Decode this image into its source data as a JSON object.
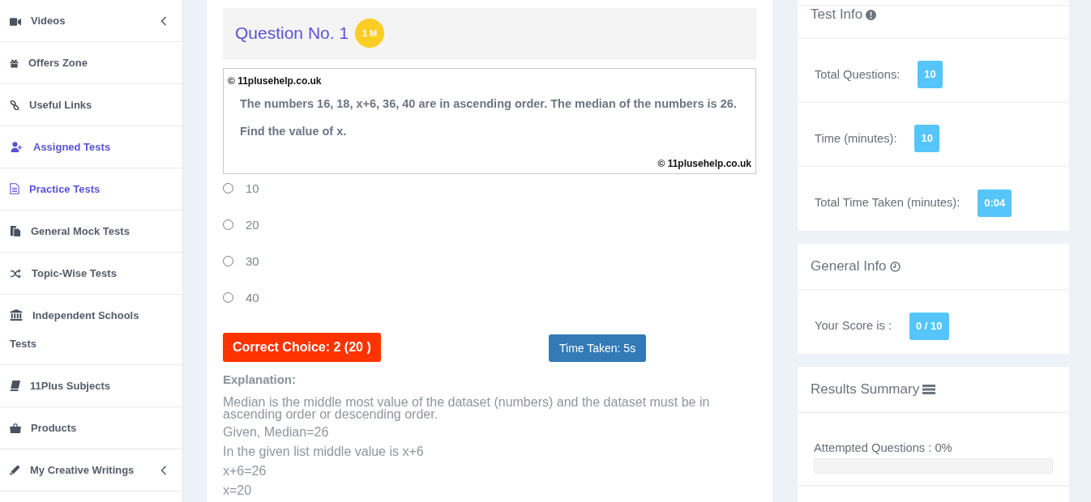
{
  "sidebar": {
    "items": [
      {
        "label": "Videos",
        "selected": false,
        "submenu": true
      },
      {
        "label": "Offers Zone",
        "selected": false,
        "submenu": false
      },
      {
        "label": "Useful Links",
        "selected": false,
        "submenu": false
      },
      {
        "label": "Assigned Tests",
        "selected": true,
        "submenu": false
      },
      {
        "label": "Practice Tests",
        "selected": true,
        "submenu": false
      },
      {
        "label": "General Mock Tests",
        "selected": false,
        "submenu": false
      },
      {
        "label": "Topic-Wise Tests",
        "selected": false,
        "submenu": false
      },
      {
        "label": "Independent Schools Tests",
        "selected": false,
        "submenu": false
      },
      {
        "label": "11Plus Subjects",
        "selected": false,
        "submenu": false
      },
      {
        "label": "Products",
        "selected": false,
        "submenu": false
      },
      {
        "label": "My Creative Writings",
        "selected": false,
        "submenu": true
      }
    ]
  },
  "question": {
    "title": "Question No. 1",
    "marks_badge": "1 M",
    "copyright_top": "© 11plusehelp.co.uk",
    "text_lines": [
      "The numbers 16, 18, x+6, 36, 40 are in ascending order. The median of the numbers is 26.",
      "Find the value of x."
    ],
    "copyright_bottom": "© 11plusehelp.co.uk",
    "options": [
      {
        "label": "10",
        "selected": false
      },
      {
        "label": "20",
        "selected": false
      },
      {
        "label": "30",
        "selected": false
      },
      {
        "label": "40",
        "selected": false
      }
    ],
    "correct_choice": "Correct Choice: 2 (20 )",
    "time_taken": "Time Taken: 5s",
    "explanation": {
      "label": "Explanation:",
      "paragraph": "Median is the middle most value of the dataset (numbers) and the dataset must be in ascending order or descending order.",
      "lines": [
        "Given, Median=26",
        "In the given list middle value is x+6",
        "x+6=26",
        "x=20"
      ]
    }
  },
  "test_info": {
    "title": "Test Info",
    "rows": [
      {
        "label": "Total Questions:",
        "value": "10"
      },
      {
        "label": "Time (minutes):",
        "value": "10"
      },
      {
        "label": "Total Time Taken (minutes):",
        "value": "0:04"
      }
    ]
  },
  "general_info": {
    "title": "General Info",
    "rows": [
      {
        "label": "Your Score is :",
        "value": "0 / 10"
      }
    ]
  },
  "results_summary": {
    "title": "Results Summary",
    "progress": [
      {
        "label": "Attempted Questions : 0%",
        "level": 0
      }
    ]
  }
}
